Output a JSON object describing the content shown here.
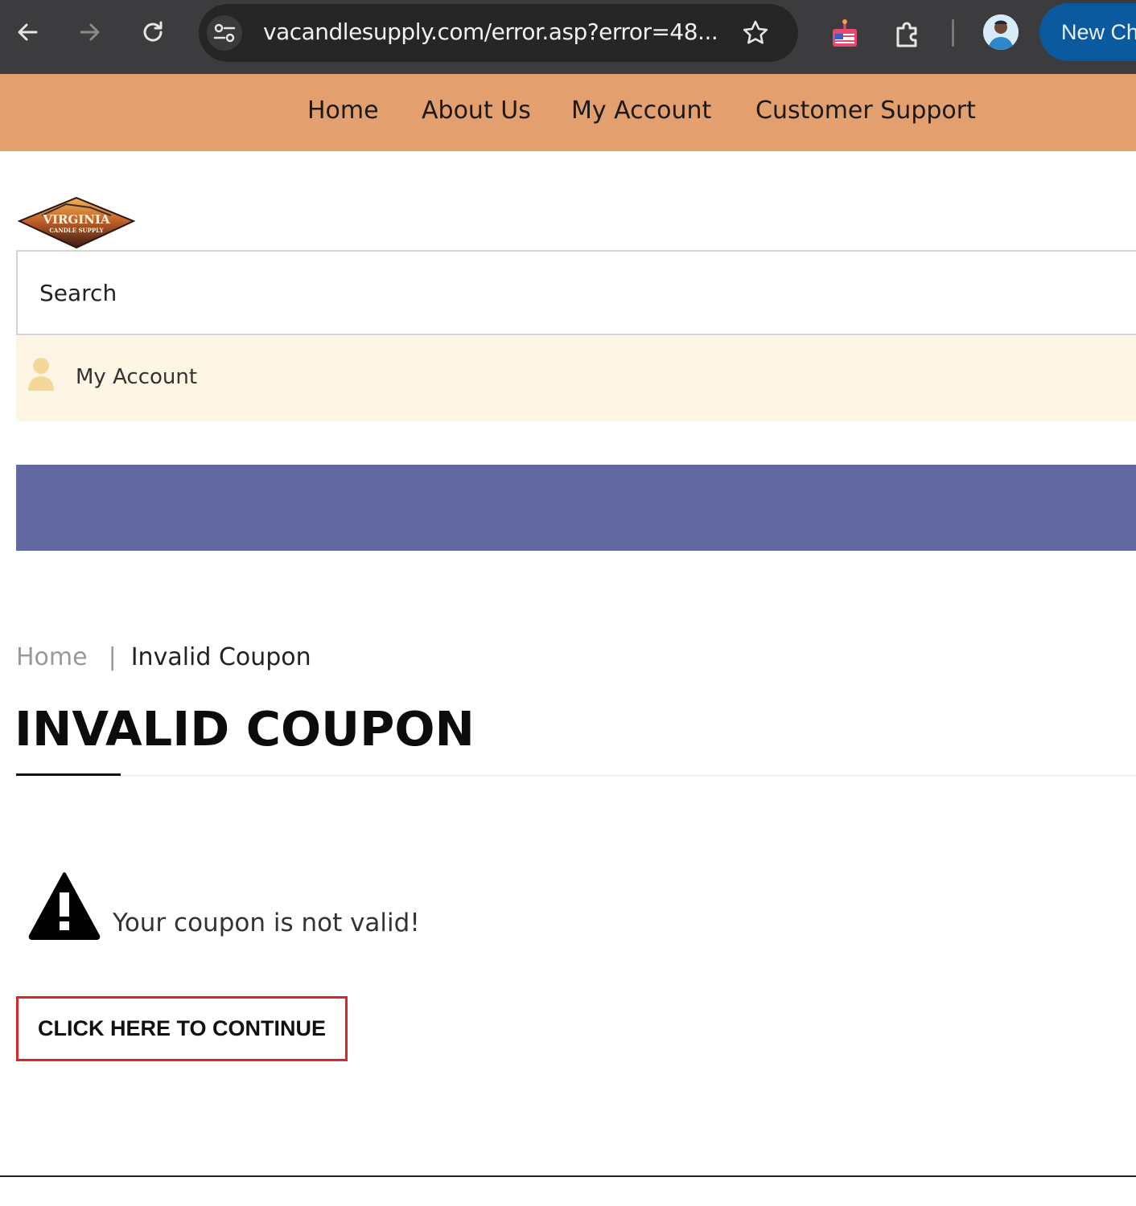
{
  "browser": {
    "url": "vacandlesupply.com/error.asp?error=48...",
    "new_chrome_label": "New Chr"
  },
  "topnav": {
    "items": [
      {
        "label": "Home"
      },
      {
        "label": "About Us"
      },
      {
        "label": "My Account"
      },
      {
        "label": "Customer Support"
      }
    ]
  },
  "logo": {
    "line1": "VIRGINIA",
    "line2": "CANDLE SUPPLY"
  },
  "search": {
    "placeholder": "Search",
    "value": ""
  },
  "account": {
    "label": "My Account"
  },
  "breadcrumb": {
    "home": "Home",
    "separator": "|",
    "current": "Invalid Coupon"
  },
  "page": {
    "title": "INVALID COUPON",
    "message": "Your coupon is not valid!",
    "continue_label": "CLICK HERE TO CONTINUE"
  },
  "colors": {
    "nav_bg": "#e3a06e",
    "account_bg": "#fdf6e4",
    "banner_bg": "#6268a1",
    "button_border": "#d8262b",
    "chrome_bg": "#3c3c3e",
    "new_chrome_bg": "#0b5aa0"
  },
  "icons": [
    "back-arrow-icon",
    "forward-arrow-icon",
    "reload-icon",
    "site-settings-icon",
    "bookmark-star-icon",
    "extension-flag-icon",
    "puzzle-extensions-icon",
    "profile-avatar-icon",
    "user-icon",
    "warning-icon"
  ]
}
